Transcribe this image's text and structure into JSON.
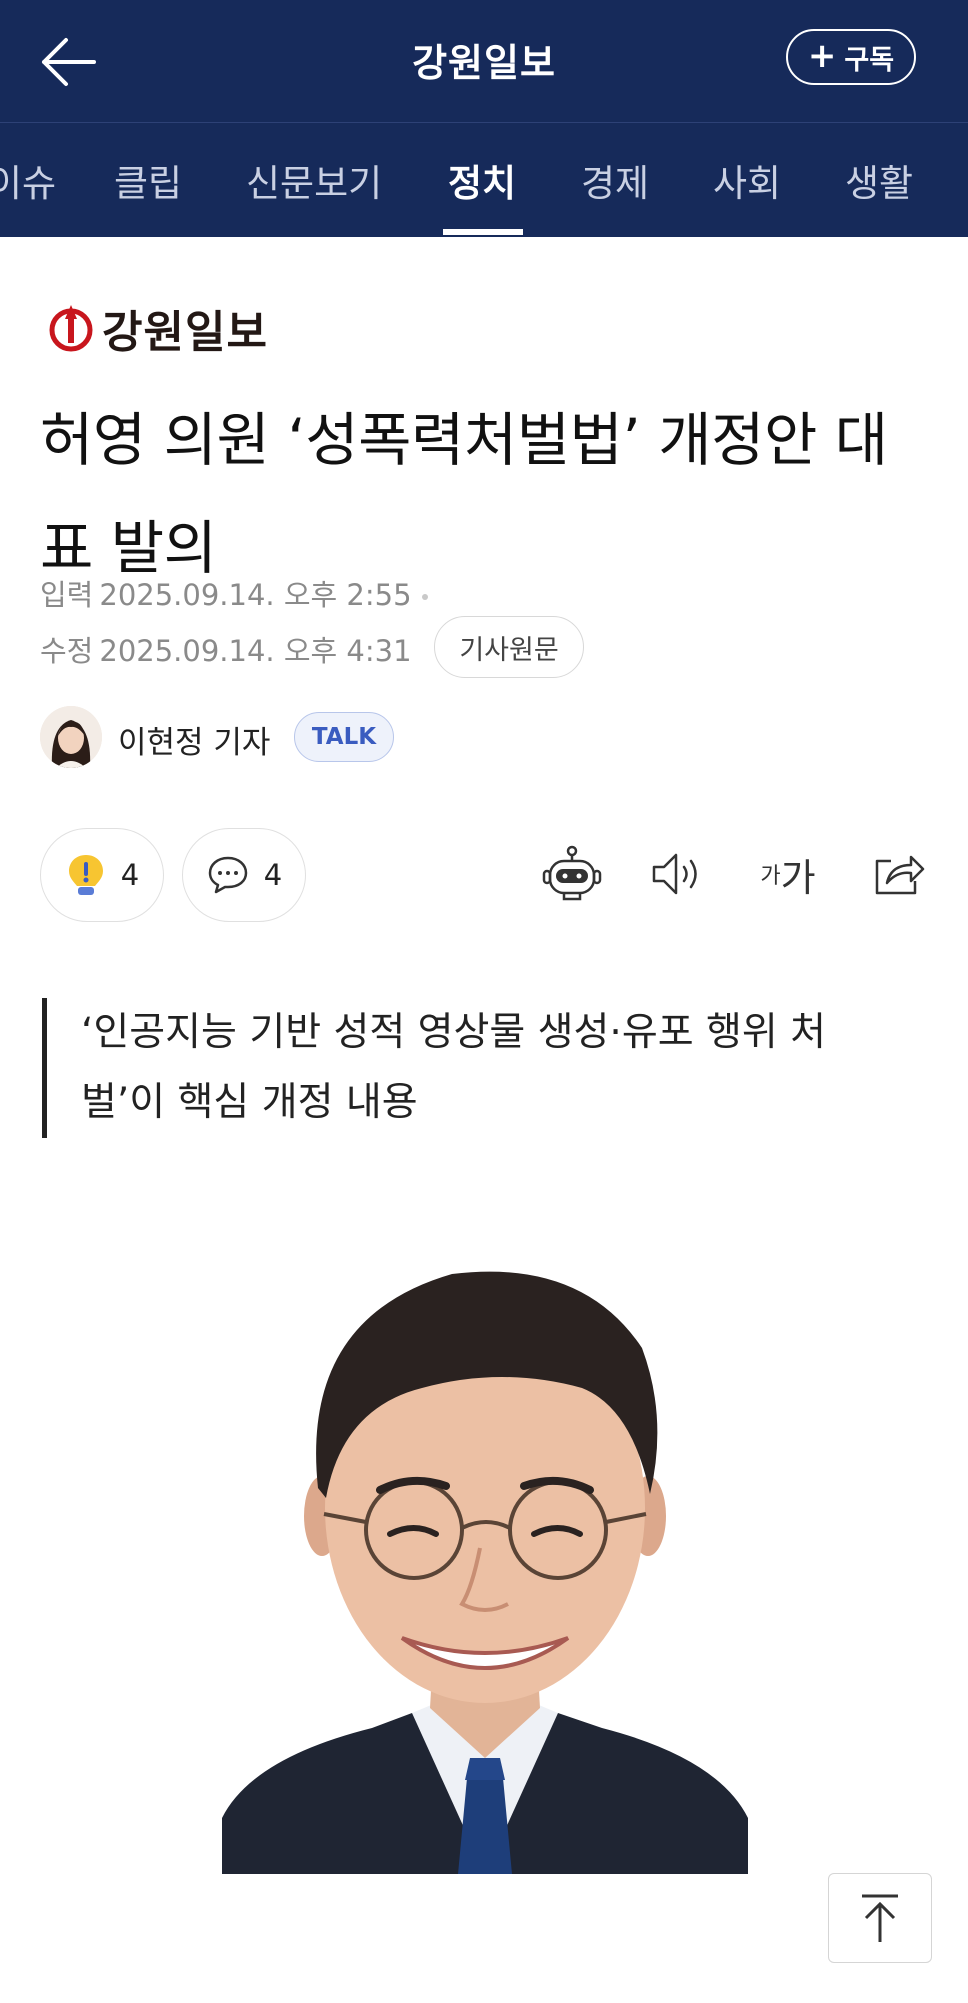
{
  "header": {
    "title": "강원일보",
    "subscribe_label": "구독",
    "back_icon": "arrow-left-icon"
  },
  "tabs": [
    {
      "label": "이슈",
      "active": false
    },
    {
      "label": "클립",
      "active": false
    },
    {
      "label": "신문보기",
      "active": false
    },
    {
      "label": "정치",
      "active": true
    },
    {
      "label": "경제",
      "active": false
    },
    {
      "label": "사회",
      "active": false
    },
    {
      "label": "생활",
      "active": false
    }
  ],
  "article": {
    "brand": "강원일보",
    "headline": "허영 의원 ‘성폭력처벌법’ 개정안 대표 발의",
    "input_label": "입력",
    "input_time": "2025.09.14. 오후 2:55",
    "modified_label": "수정",
    "modified_time": "2025.09.14. 오후 4:31",
    "source_button": "기사원문",
    "reporter": "이현정 기자",
    "talk_badge": "TALK",
    "reactions": {
      "like_count": "4",
      "comment_count": "4"
    },
    "summary": "‘인공지능 기반 성적 영상물 생성·유포 행위 처벌’이 핵심 개정 내용"
  },
  "toolbar": {
    "summary_bot_icon": "robot-icon",
    "tts_icon": "speaker-icon",
    "font_small": "가",
    "font_big": "가",
    "share_icon": "share-icon"
  },
  "colors": {
    "header_bg": "#162a5a",
    "brand_red": "#c8161d",
    "talk_blue": "#3a5cc0"
  }
}
